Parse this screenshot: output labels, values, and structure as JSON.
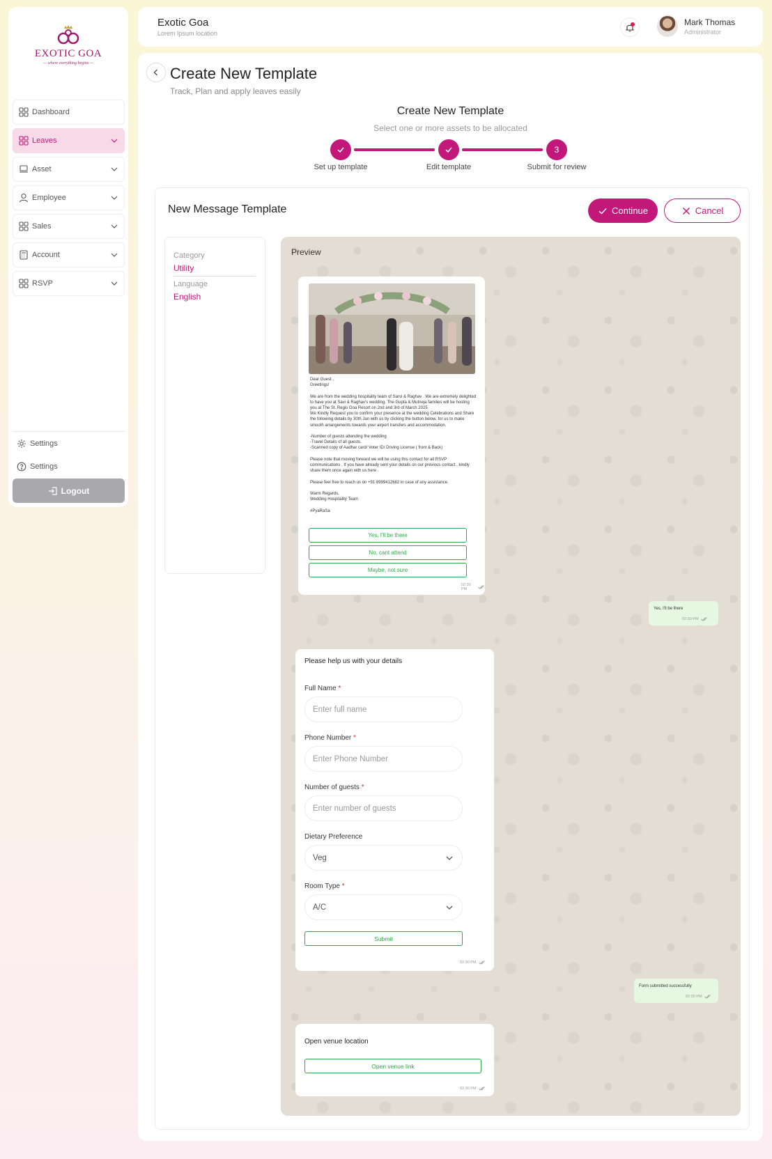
{
  "brand": {
    "logo_text": "EXOTIC GOA",
    "tagline": "— where everything begins —"
  },
  "sidebar": {
    "items": [
      {
        "label": "Dashboard",
        "icon": "grid-icon",
        "active": false,
        "has_chevron": false
      },
      {
        "label": "Leaves",
        "icon": "grid-icon",
        "active": true,
        "has_chevron": true
      },
      {
        "label": "Asset",
        "icon": "laptop-icon",
        "active": false,
        "has_chevron": true
      },
      {
        "label": "Employee",
        "icon": "user-icon",
        "active": false,
        "has_chevron": true
      },
      {
        "label": "Sales",
        "icon": "grid-icon",
        "active": false,
        "has_chevron": true
      },
      {
        "label": "Account",
        "icon": "calculator-icon",
        "active": false,
        "has_chevron": true
      },
      {
        "label": "RSVP",
        "icon": "grid-icon",
        "active": false,
        "has_chevron": true
      }
    ],
    "footer": {
      "settings_label": "Settings",
      "help_label": "Settings",
      "logout_label": "Logout"
    }
  },
  "topbar": {
    "org_name": "Exotic Goa",
    "org_location": "Lorem Ipsum location",
    "user_name": "Mark Thomas",
    "user_role": "Administrator"
  },
  "page": {
    "title": "Create New Template",
    "subtitle": "Track, Plan  and apply leaves easily"
  },
  "stepper": {
    "title": "Create New Template",
    "subtitle": "Select one or more assets to be allocated",
    "steps": [
      {
        "label": "Set up template",
        "status": "done",
        "number": "1"
      },
      {
        "label": "Edit template",
        "status": "done",
        "number": "2"
      },
      {
        "label": "Submit for review",
        "status": "current",
        "number": "3"
      }
    ]
  },
  "template": {
    "title": "New Message Template",
    "continue_label": "Continue",
    "cancel_label": "Cancel",
    "category_label": "Category",
    "category_value": "Utility",
    "language_label": "Language",
    "language_value": "English"
  },
  "preview": {
    "label": "Preview",
    "message_text": "Dear Guest ,\nGreetings!\n\nWe are from the wedding hospitality team of Sarvi & Raghav .  We are extremely delighted to have you at Savi & Raghav's wedding. The Gupta & Mutneja families will be hosting you at The St. Regis Goa Resort on 2nd and 3rd of March 2025\nWe Kindly Request you to confirm your presence at the wedding Celebrations and Share the following details by 30th Jan with us by clicking the button below, for us to make smooth arrangements towards your airport transfers and accommodation.\n\n-Number of guests attending the wedding\n-Travel Details of all guests.\n-Scanned copy of Aadhar card/ Voter ID/ Driving License ( front & Back)\n\nPlease note that moving forward we will be using this contact for all RSVP communications . If you have already sent your details on our previous contact , kindly share them once again with us here .\n\nPlease feel free to reach us on +91 8999412682 in case of any assistance.\n\nWarm Regards,\nWedding Hospitality Team\n\n#PyaRaSa",
    "quick_replies": [
      "Yes, I'll be there",
      "No, cant attend",
      "Maybe, not sure"
    ],
    "time": "02:30 PM",
    "reply_1": "Yes, I'll be there",
    "form": {
      "title": "Please help us with your details",
      "full_name_label": "Full Name",
      "full_name_placeholder": "Enter full name",
      "phone_label": "Phone Number",
      "phone_placeholder": "Enter Phone Number",
      "guests_label": "Number of guests",
      "guests_placeholder": "Enter number of guests",
      "dietary_label": "Dietary Preference",
      "dietary_value": "Veg",
      "room_label": "Room Type",
      "room_value": "A/C",
      "submit_label": "Submit",
      "required_mark": "*"
    },
    "reply_2": "Form submitted successfully",
    "venue_text": "Open venue location",
    "venue_button": "Open venue link"
  },
  "colors": {
    "accent": "#c2187a",
    "accent_light": "#f7d9e8",
    "whatsapp_green": "#2ea84a",
    "chat_bg": "#e3ddd3",
    "outgoing_bubble": "#e6f8e2"
  }
}
